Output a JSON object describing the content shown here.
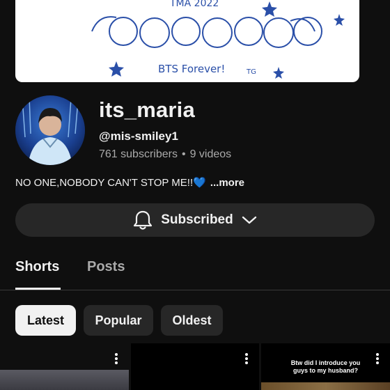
{
  "banner": {
    "top_text": "TMA 2022",
    "bottom_text": "BTS Forever!",
    "signature": "TG"
  },
  "channel": {
    "name": "its_maria",
    "handle": "@mis-smiley1",
    "subscribers": "761 subscribers",
    "separator": "•",
    "videos": "9 videos",
    "description": "NO ONE,NOBODY CAN'T STOP ME!!",
    "description_emoji": "💙",
    "more_label": "...more"
  },
  "subscribe": {
    "label": "Subscribed",
    "bell_icon": "bell-icon",
    "chevron_icon": "chevron-down-icon"
  },
  "tabs": [
    {
      "label": "Shorts",
      "active": true
    },
    {
      "label": "Posts",
      "active": false
    }
  ],
  "filters": [
    {
      "label": "Latest",
      "selected": true
    },
    {
      "label": "Popular",
      "selected": false
    },
    {
      "label": "Oldest",
      "selected": false
    }
  ],
  "shorts": [
    {
      "caption": ""
    },
    {
      "caption": ""
    },
    {
      "caption": "Btw did I introduce you guys to my husband?"
    }
  ],
  "colors": {
    "background": "#0f0f0f",
    "button": "#272727",
    "chip_selected": "#f1f1f1",
    "secondary_text": "#aaaaaa",
    "heart": "#5ec4ff"
  }
}
